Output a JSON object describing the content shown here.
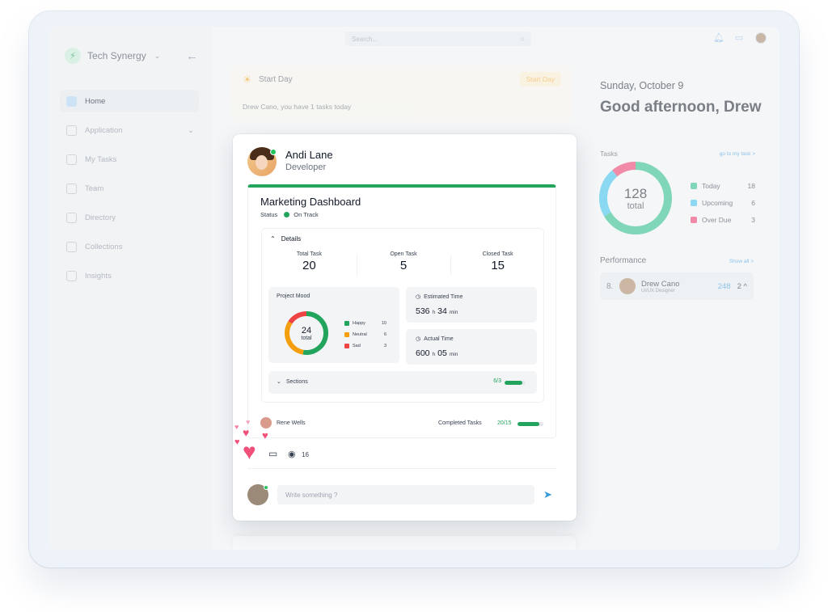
{
  "brand": {
    "name": "Tech Synergy"
  },
  "sidebar": {
    "items": [
      {
        "label": "Home",
        "icon": "home-icon",
        "active": true
      },
      {
        "label": "Application",
        "icon": "grid-icon",
        "has_children": true
      },
      {
        "label": "My Tasks",
        "icon": "checkbox-icon"
      },
      {
        "label": "Team",
        "icon": "users-icon"
      },
      {
        "label": "Directory",
        "icon": "book-icon"
      },
      {
        "label": "Collections",
        "icon": "folder-icon"
      },
      {
        "label": "Insights",
        "icon": "chart-icon"
      }
    ]
  },
  "topbar": {
    "search_placeholder": "Search..."
  },
  "start_day": {
    "title": "Start Day",
    "button": "Start Day",
    "message": "Drew Cano, you have 1 tasks today"
  },
  "post": {
    "user_name": "Andi Lane",
    "user_role": "Developer",
    "dashboard_title": "Marketing Dashboard",
    "status_label": "Status",
    "status_value": "On Track",
    "details_label": "Details",
    "stats": [
      {
        "label": "Total Task",
        "value": "20"
      },
      {
        "label": "Open Task",
        "value": "5"
      },
      {
        "label": "Closed Task",
        "value": "15"
      }
    ],
    "mood": {
      "title": "Project Mood",
      "total": "24",
      "total_label": "total",
      "items": [
        {
          "label": "Happy",
          "value": 10,
          "color": "#22a45d"
        },
        {
          "label": "Neutral",
          "value": 6,
          "color": "#f59e0b"
        },
        {
          "label": "Sad",
          "value": 3,
          "color": "#ef4444"
        }
      ]
    },
    "estimated": {
      "title": "Estimated Time",
      "hours": "536",
      "h": "h",
      "minutes": "34",
      "min": "min"
    },
    "actual": {
      "title": "Actual Time",
      "hours": "600",
      "h": "h",
      "minutes": "05",
      "min": "min"
    },
    "sections": {
      "label": "Sections",
      "progress_text": "6/3",
      "progress": 0.85
    },
    "assignee": "Rene Wells",
    "completed_label": "Completed Tasks",
    "completed_value": "20/15",
    "completed_progress": 0.85,
    "views": "16",
    "comment_placeholder": "Write something ?"
  },
  "right_panel": {
    "date": "Sunday, October 9",
    "greeting": "Good afternoon, Drew",
    "tasks_label": "Tasks",
    "tasks_link": "go to my task >",
    "total": "128",
    "total_label": "total",
    "legend": [
      {
        "label": "Today",
        "value": 18,
        "color": "#7fd6b9"
      },
      {
        "label": "Upcoming",
        "value": 6,
        "color": "#8ad8f2"
      },
      {
        "label": "Over Due",
        "value": 3,
        "color": "#f08aa6"
      }
    ],
    "performance_label": "Performance",
    "performance_link": "Show all >",
    "performer": {
      "rank": "8.",
      "name": "Drew Cano",
      "role": "UI/UX Designer",
      "score": "248",
      "change": "2"
    }
  },
  "colors": {
    "accent_green": "#22a45d",
    "link_blue": "#8cc3ea",
    "heart_pink": "#f0507a"
  }
}
